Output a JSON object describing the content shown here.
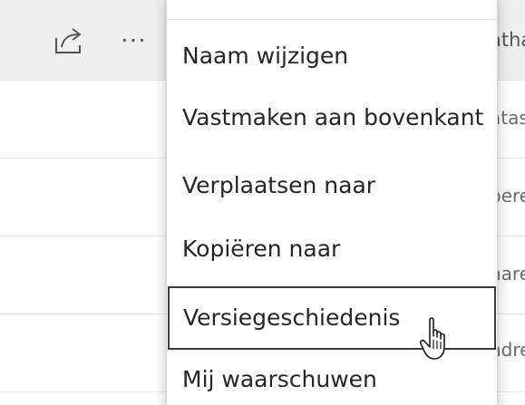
{
  "toolbar": {
    "share_icon": "share-icon",
    "more_icon": "more-icon",
    "more_label": "···"
  },
  "column_peek": {
    "header": "atha",
    "rows": [
      "atas",
      "pere",
      "nare",
      "ndre"
    ]
  },
  "context_menu": {
    "items": [
      {
        "label": "Naam wijzigen",
        "hovered": false
      },
      {
        "label": "Vastmaken aan bovenkant",
        "hovered": false
      },
      {
        "label": "Verplaatsen naar",
        "hovered": false
      },
      {
        "label": "Kopiëren naar",
        "hovered": false
      },
      {
        "label": "Versiegeschiedenis",
        "hovered": true
      },
      {
        "label": "Mij waarschuwen",
        "hovered": false
      }
    ]
  },
  "cursor": {
    "icon": "hand-pointer-icon"
  },
  "colors": {
    "header_bg": "#efefef",
    "menu_text": "#262626",
    "focus_border": "#3b3b3b"
  }
}
